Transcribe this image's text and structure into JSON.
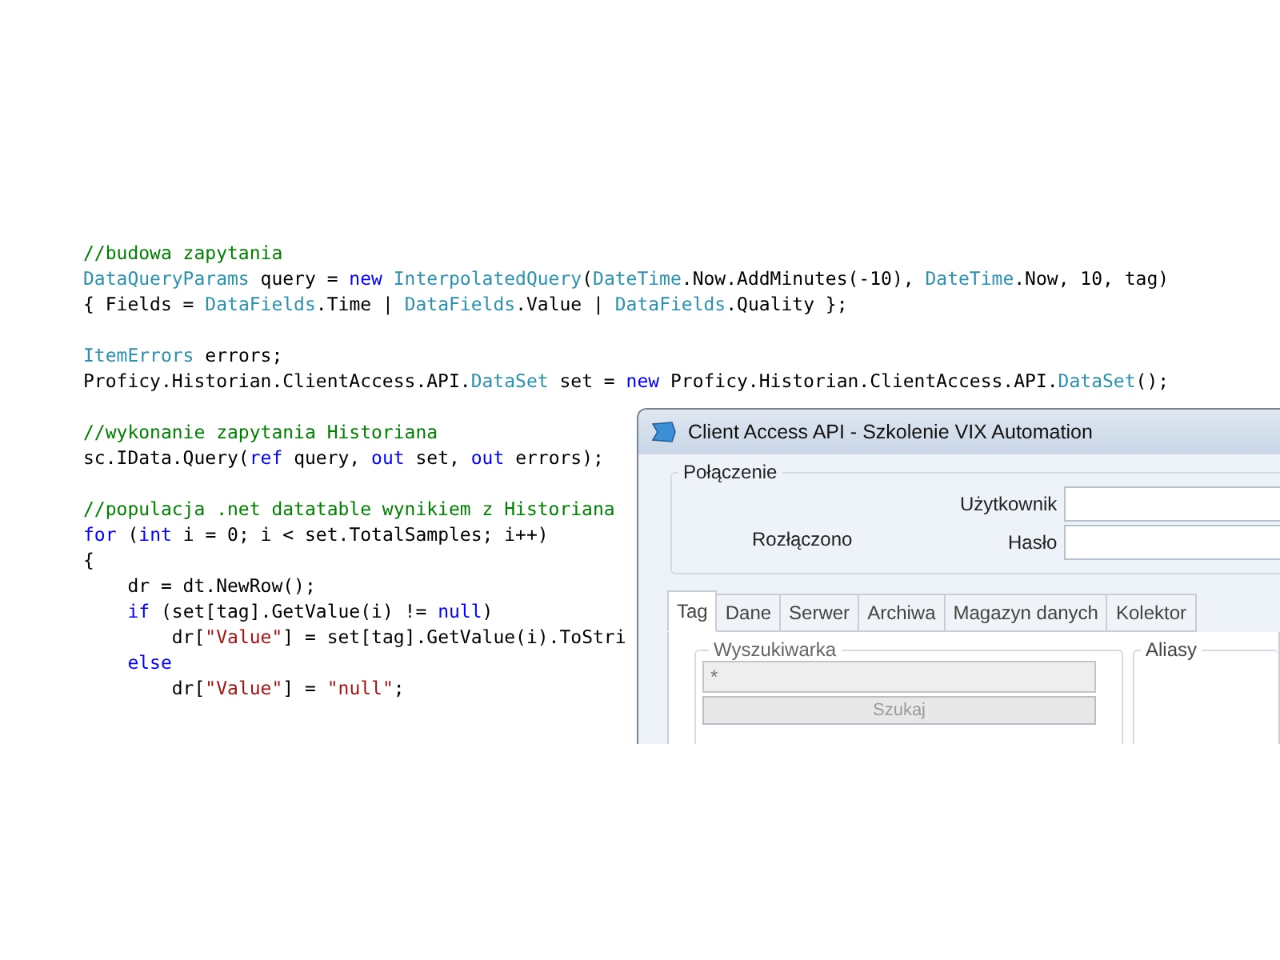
{
  "code": {
    "blocks": [
      [
        {
          "tokens": [
            {
              "kind": "comment",
              "text": "//budowa zapytania"
            }
          ]
        },
        {
          "tokens": [
            {
              "kind": "type",
              "text": "DataQueryParams"
            },
            {
              "kind": "plain",
              "text": " query = "
            },
            {
              "kind": "keyword",
              "text": "new"
            },
            {
              "kind": "type",
              "text": " InterpolatedQuery"
            },
            {
              "kind": "plain",
              "text": "("
            },
            {
              "kind": "type",
              "text": "DateTime"
            },
            {
              "kind": "plain",
              "text": ".Now.AddMinutes(-10), "
            },
            {
              "kind": "type",
              "text": "DateTime"
            },
            {
              "kind": "plain",
              "text": ".Now, 10, tag)"
            }
          ]
        },
        {
          "tokens": [
            {
              "kind": "plain",
              "text": "{ Fields = "
            },
            {
              "kind": "type",
              "text": "DataFields"
            },
            {
              "kind": "plain",
              "text": ".Time | "
            },
            {
              "kind": "type",
              "text": "DataFields"
            },
            {
              "kind": "plain",
              "text": ".Value | "
            },
            {
              "kind": "type",
              "text": "DataFields"
            },
            {
              "kind": "plain",
              "text": ".Quality };"
            }
          ]
        }
      ],
      [
        {
          "tokens": [
            {
              "kind": "type",
              "text": "ItemErrors"
            },
            {
              "kind": "plain",
              "text": " errors;"
            }
          ]
        },
        {
          "tokens": [
            {
              "kind": "plain",
              "text": "Proficy.Historian.ClientAccess.API."
            },
            {
              "kind": "type",
              "text": "DataSet"
            },
            {
              "kind": "plain",
              "text": " set = "
            },
            {
              "kind": "keyword",
              "text": "new"
            },
            {
              "kind": "plain",
              "text": " Proficy.Historian.ClientAccess.API."
            },
            {
              "kind": "type",
              "text": "DataSet"
            },
            {
              "kind": "plain",
              "text": "();"
            }
          ]
        }
      ],
      [
        {
          "tokens": [
            {
              "kind": "comment",
              "text": "//wykonanie zapytania Historiana"
            }
          ]
        },
        {
          "tokens": [
            {
              "kind": "plain",
              "text": "sc.IData.Query("
            },
            {
              "kind": "keyword",
              "text": "ref"
            },
            {
              "kind": "plain",
              "text": " query, "
            },
            {
              "kind": "keyword",
              "text": "out"
            },
            {
              "kind": "plain",
              "text": " set, "
            },
            {
              "kind": "keyword",
              "text": "out"
            },
            {
              "kind": "plain",
              "text": " errors);"
            }
          ]
        }
      ],
      [
        {
          "tokens": [
            {
              "kind": "comment",
              "text": "//populacja .net datatable wynikiem z Historiana"
            }
          ]
        },
        {
          "tokens": [
            {
              "kind": "keyword",
              "text": "for"
            },
            {
              "kind": "plain",
              "text": " ("
            },
            {
              "kind": "keyword",
              "text": "int"
            },
            {
              "kind": "plain",
              "text": " i = 0; i < set.TotalSamples; i++)"
            }
          ]
        },
        {
          "tokens": [
            {
              "kind": "plain",
              "text": "{"
            }
          ]
        },
        {
          "tokens": [
            {
              "kind": "plain",
              "text": "    dr = dt.NewRow();"
            }
          ]
        },
        {
          "tokens": [
            {
              "kind": "keyword",
              "text": "    if"
            },
            {
              "kind": "plain",
              "text": " (set[tag].GetValue(i) != "
            },
            {
              "kind": "keyword",
              "text": "null"
            },
            {
              "kind": "plain",
              "text": ")"
            }
          ]
        },
        {
          "tokens": [
            {
              "kind": "plain",
              "text": "        dr["
            },
            {
              "kind": "string",
              "text": "\"Value\""
            },
            {
              "kind": "plain",
              "text": "] = set[tag].GetValue(i).ToStri"
            }
          ]
        },
        {
          "tokens": [
            {
              "kind": "keyword",
              "text": "    else"
            }
          ]
        },
        {
          "tokens": [
            {
              "kind": "plain",
              "text": "        dr["
            },
            {
              "kind": "string",
              "text": "\"Value\""
            },
            {
              "kind": "plain",
              "text": "] = "
            },
            {
              "kind": "string",
              "text": "\"null\""
            },
            {
              "kind": "plain",
              "text": ";"
            }
          ]
        }
      ]
    ]
  },
  "dialog": {
    "title": "Client Access API - Szkolenie VIX Automation",
    "connection": {
      "title": "Połączenie",
      "status": "Rozłączono",
      "fields": [
        {
          "label": "Użytkownik"
        },
        {
          "label": "Hasło"
        }
      ]
    },
    "tabs": [
      {
        "label": "Tag",
        "selected": true
      },
      {
        "label": "Dane",
        "selected": false
      },
      {
        "label": "Serwer",
        "selected": false
      },
      {
        "label": "Archiwa",
        "selected": false
      },
      {
        "label": "Magazyn danych",
        "selected": false
      },
      {
        "label": "Kolektor",
        "selected": false
      }
    ],
    "search": {
      "title": "Wyszukiwarka",
      "value": "*",
      "button": "Szukaj",
      "disabled": true
    },
    "aliases": {
      "title": "Aliasy"
    }
  }
}
